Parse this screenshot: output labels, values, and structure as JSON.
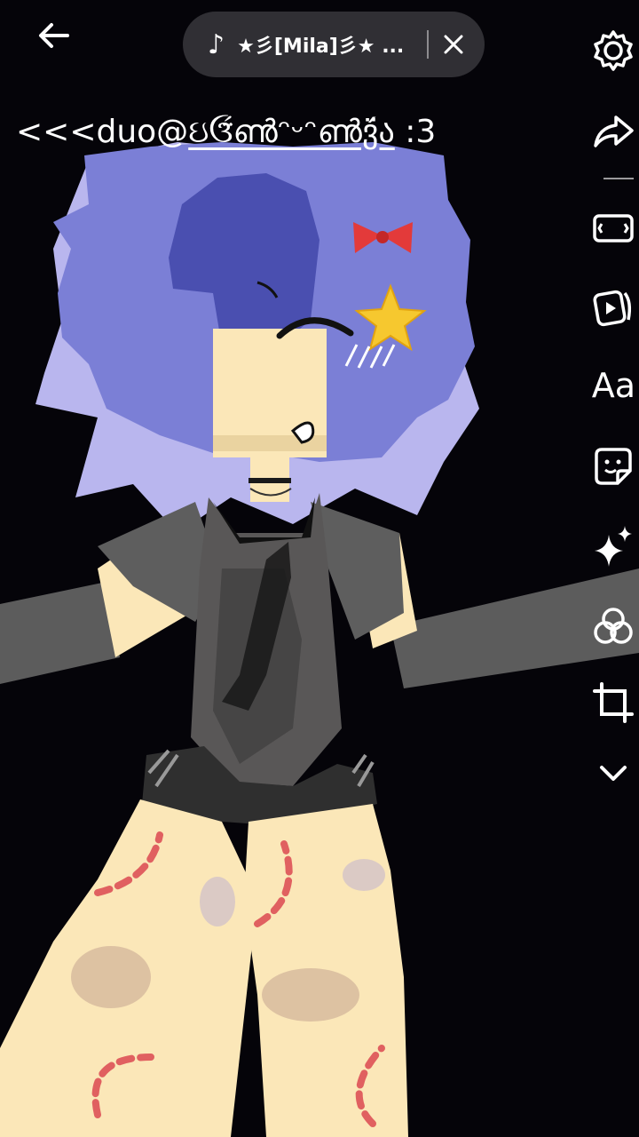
{
  "sound": {
    "title": "★彡[Mila]彡★ ...",
    "note_icon": "music-note-icon"
  },
  "caption": {
    "prefix": "<<<duo@",
    "handle": "ઇઉ̈́ൺᵔᵕᵔൺვ̈́ა",
    "suffix": " :3"
  },
  "tools": {
    "text_label": "Aa"
  },
  "colors": {
    "hair": "#7b7fd6",
    "hair_light": "#b9b6ee",
    "hair_dark": "#4a4fb0",
    "skin": "#fbe7b8",
    "jacket": "#5e5e5e",
    "background": "#050409"
  }
}
